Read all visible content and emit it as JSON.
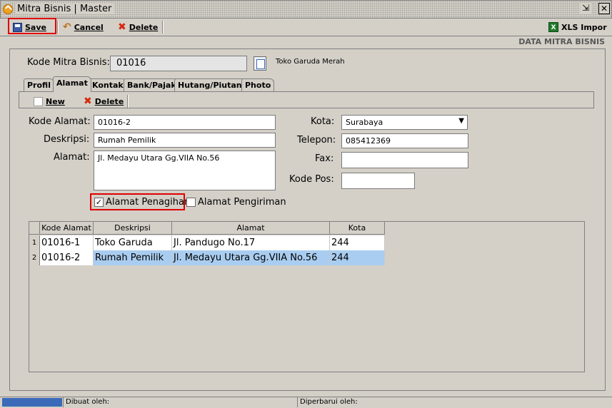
{
  "window": {
    "title": "Mitra Bisnis | Master"
  },
  "toolbar": {
    "save": "Save",
    "cancel": "Cancel",
    "delete": "Delete",
    "xls": "XLS Impor"
  },
  "header": {
    "section": "DATA MITRA BISNIS"
  },
  "partner": {
    "code_label": "Kode Mitra Bisnis:",
    "code": "01016",
    "name": "Toko Garuda Merah"
  },
  "tabs": [
    "Profil",
    "Alamat",
    "Kontak",
    "Bank/Pajak",
    "Hutang/Piutang",
    "Photo"
  ],
  "subtoolbar": {
    "new": "New",
    "delete": "Delete"
  },
  "form": {
    "kode_label": "Kode Alamat:",
    "kode": "01016-2",
    "deskripsi_label": "Deskripsi:",
    "deskripsi": "Rumah Pemilik",
    "alamat_label": "Alamat:",
    "alamat": "Jl. Medayu Utara Gg.VIIA No.56",
    "kota_label": "Kota:",
    "kota": "Surabaya",
    "telepon_label": "Telepon:",
    "telepon": "085412369",
    "fax_label": "Fax:",
    "fax": "",
    "kodepos_label": "Kode Pos:",
    "kodepos": "",
    "penagihan_label": "Alamat Penagihan",
    "penagihan_checked": true,
    "pengiriman_label": "Alamat Pengiriman",
    "pengiriman_checked": false
  },
  "grid": {
    "headers": [
      "Kode Alamat",
      "Deskripsi",
      "Alamat",
      "Kota"
    ],
    "rows": [
      {
        "n": "1",
        "kode": "01016-1",
        "deskripsi": "Toko Garuda",
        "alamat": "Jl. Pandugo No.17",
        "kota": "244"
      },
      {
        "n": "2",
        "kode": "01016-2",
        "deskripsi": "Rumah Pemilik",
        "alamat": "Jl. Medayu Utara Gg.VIIA No.56",
        "kota": "244"
      }
    ],
    "selected_row": 1
  },
  "status": {
    "created": "Dibuat oleh:",
    "updated": "Diperbarui oleh:"
  },
  "colors": {
    "highlight": "#e00000",
    "selection": "#a9cdf0"
  }
}
